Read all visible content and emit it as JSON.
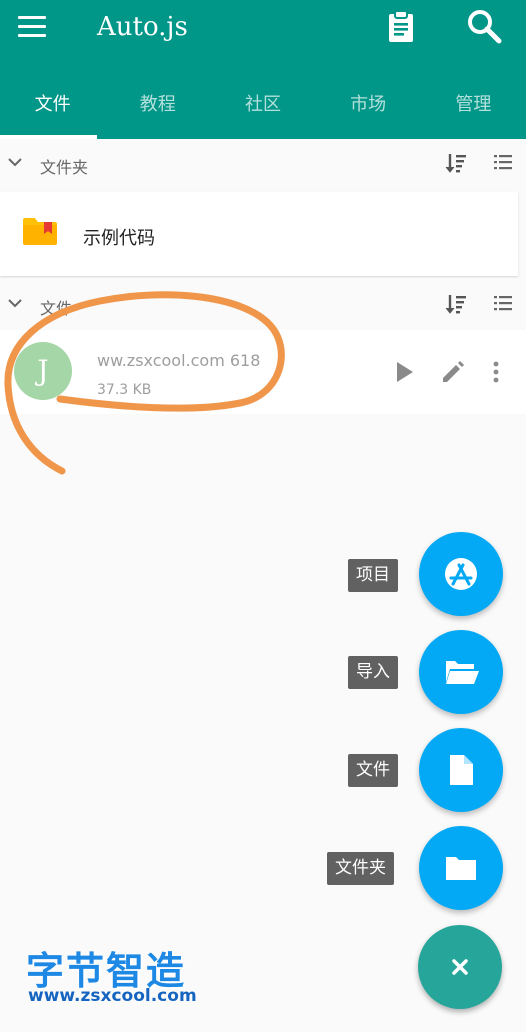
{
  "appbar": {
    "title": "Auto.js",
    "menu_icon": "menu-icon",
    "clipboard_icon": "clipboard-icon",
    "search_icon": "search-icon",
    "color": "#009688"
  },
  "tabs": [
    {
      "label": "文件",
      "active": true
    },
    {
      "label": "教程",
      "active": false
    },
    {
      "label": "社区",
      "active": false
    },
    {
      "label": "市场",
      "active": false
    },
    {
      "label": "管理",
      "active": false
    }
  ],
  "folders_section": {
    "title": "文件夹",
    "items": [
      {
        "name": "示例代码"
      }
    ]
  },
  "files_section": {
    "title": "文件",
    "items": [
      {
        "avatar_letter": "J",
        "name": "ww.zsxcool.com 618",
        "size": "37.3 KB"
      }
    ]
  },
  "fab_menu": {
    "items": [
      {
        "label": "项目",
        "icon": "app-store-icon"
      },
      {
        "label": "导入",
        "icon": "folder-open-icon"
      },
      {
        "label": "文件",
        "icon": "file-icon"
      },
      {
        "label": "文件夹",
        "icon": "folder-icon"
      }
    ],
    "close_label": "×",
    "fab_color": "#03a9f4",
    "main_color": "#26a69a"
  },
  "watermark": {
    "title": "字节智造",
    "url": "www.zsxcool.com"
  },
  "annotation": {
    "color": "#f0964b"
  }
}
